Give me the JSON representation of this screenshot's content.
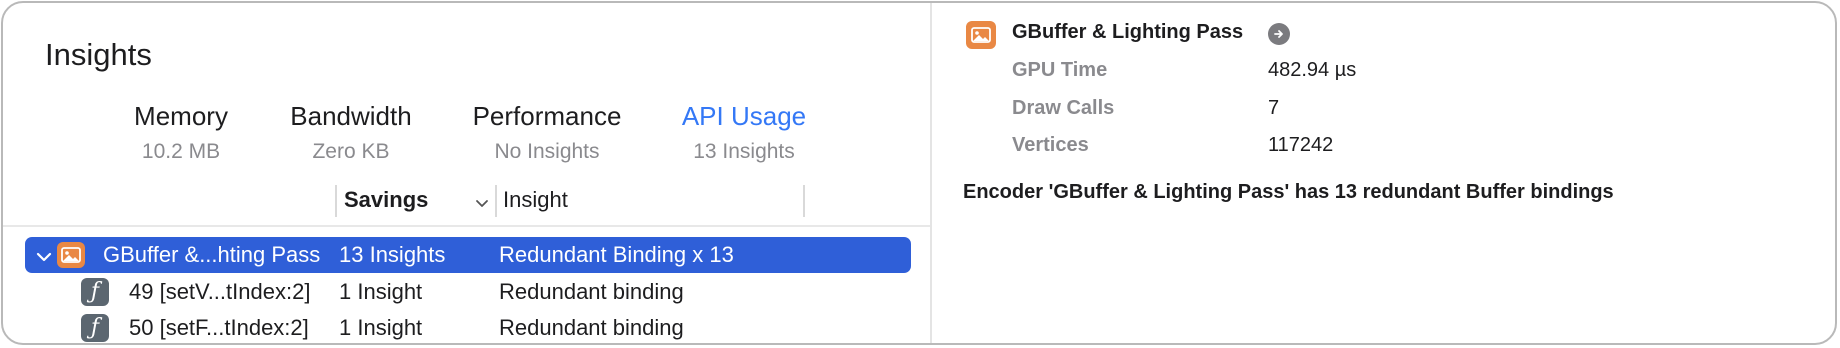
{
  "insights": {
    "title": "Insights",
    "categories": [
      {
        "name": "Memory",
        "sub": "10.2 MB"
      },
      {
        "name": "Bandwidth",
        "sub": "Zero KB"
      },
      {
        "name": "Performance",
        "sub": "No Insights"
      },
      {
        "name": "API Usage",
        "sub": "13 Insights"
      }
    ],
    "active_category": "API Usage",
    "columns": {
      "savings": "Savings",
      "insight": "Insight"
    },
    "rows": [
      {
        "name": "GBuffer &...hting Pass",
        "savings": "13 Insights",
        "insight": "Redundant Binding x 13",
        "icon": "image-icon",
        "selected": true
      },
      {
        "name": "49 [setV...tIndex:2]",
        "savings": "1 Insight",
        "insight": "Redundant binding",
        "icon": "function-icon"
      },
      {
        "name": "50 [setF...tIndex:2]",
        "savings": "1 Insight",
        "insight": "Redundant binding",
        "icon": "function-icon"
      }
    ]
  },
  "detail": {
    "title": "GBuffer & Lighting Pass",
    "properties": [
      {
        "label": "GPU Time",
        "value": "482.94 µs"
      },
      {
        "label": "Draw Calls",
        "value": "7"
      },
      {
        "label": "Vertices",
        "value": "117242"
      }
    ],
    "description": "Encoder 'GBuffer & Lighting Pass' has 13 redundant Buffer bindings"
  },
  "colors": {
    "accent": "#3478f6",
    "selection": "#2f5fd8",
    "pass_icon": "#e98844",
    "function_icon": "#5b6670"
  }
}
